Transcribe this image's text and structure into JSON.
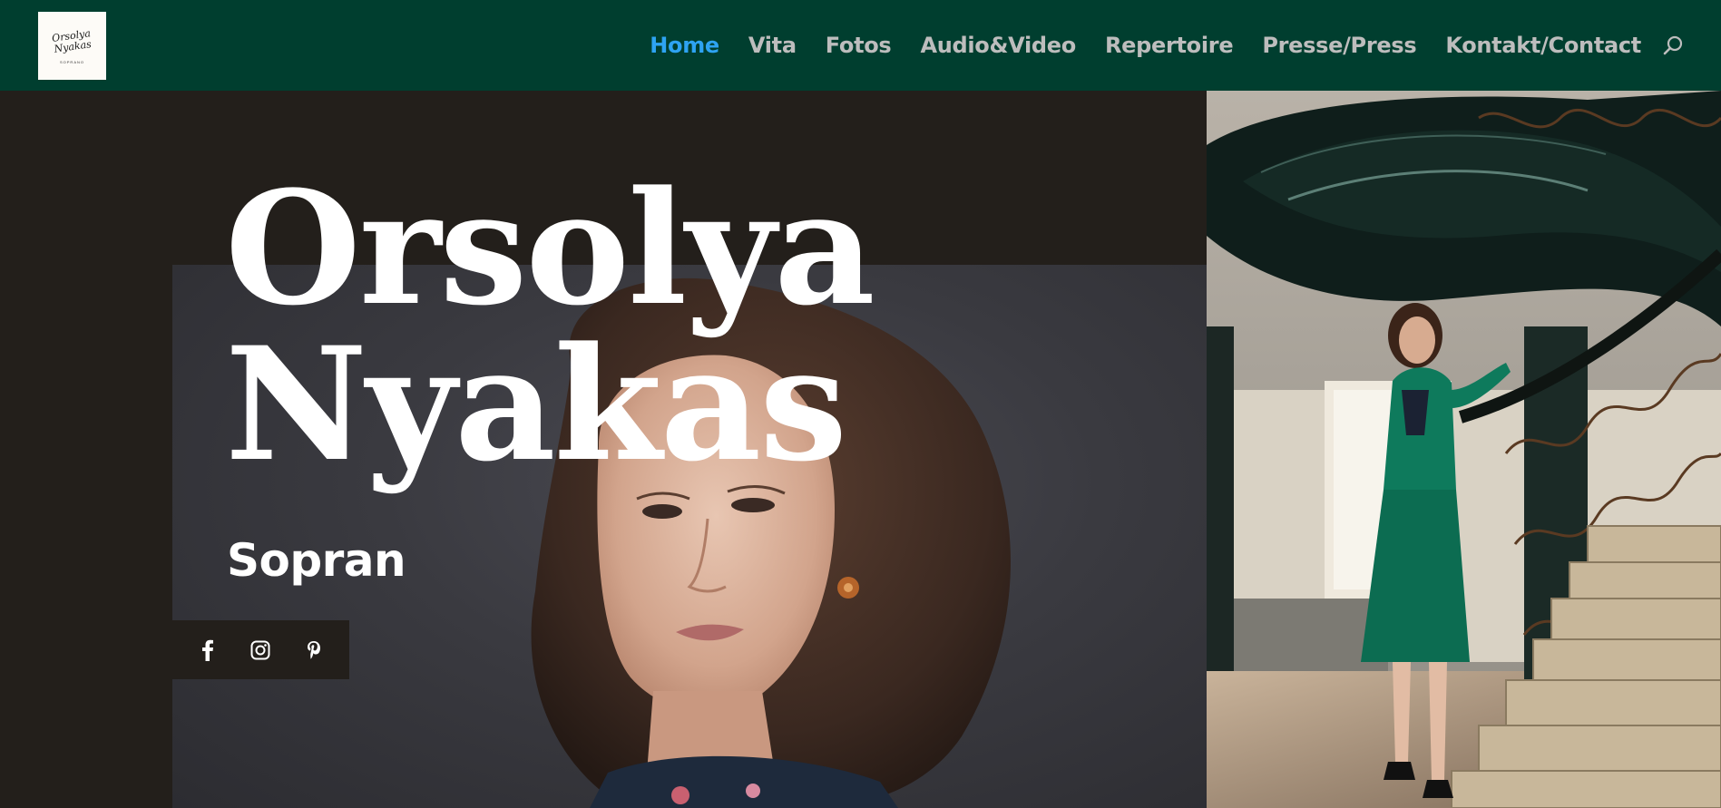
{
  "header": {
    "logo": {
      "script_text": "Orsolya\nNyakas",
      "sub_text": "SOPRANO",
      "alt": "Orsolya Nyakas logo"
    },
    "nav": [
      {
        "label": "Home",
        "active": true
      },
      {
        "label": "Vita",
        "active": false
      },
      {
        "label": "Fotos",
        "active": false
      },
      {
        "label": "Audio&Video",
        "active": false
      },
      {
        "label": "Repertoire",
        "active": false
      },
      {
        "label": "Presse/Press",
        "active": false
      },
      {
        "label": "Kontakt/Contact",
        "active": false
      }
    ],
    "search_icon": "search-icon"
  },
  "hero": {
    "name_line1": "Orsolya",
    "name_line2": "Nyakas",
    "subtitle": "Sopran",
    "social": [
      {
        "icon": "facebook-icon",
        "glyph": "f"
      },
      {
        "icon": "instagram-icon",
        "glyph": ""
      },
      {
        "icon": "pinterest-icon",
        "glyph": "p"
      }
    ]
  },
  "colors": {
    "header_bg": "#003e2f",
    "page_bg": "#231f1b",
    "nav_text": "#bdbdbd",
    "nav_active": "#2ea3f2",
    "hero_text": "#ffffff",
    "dress_green": "#0e7a5c"
  }
}
